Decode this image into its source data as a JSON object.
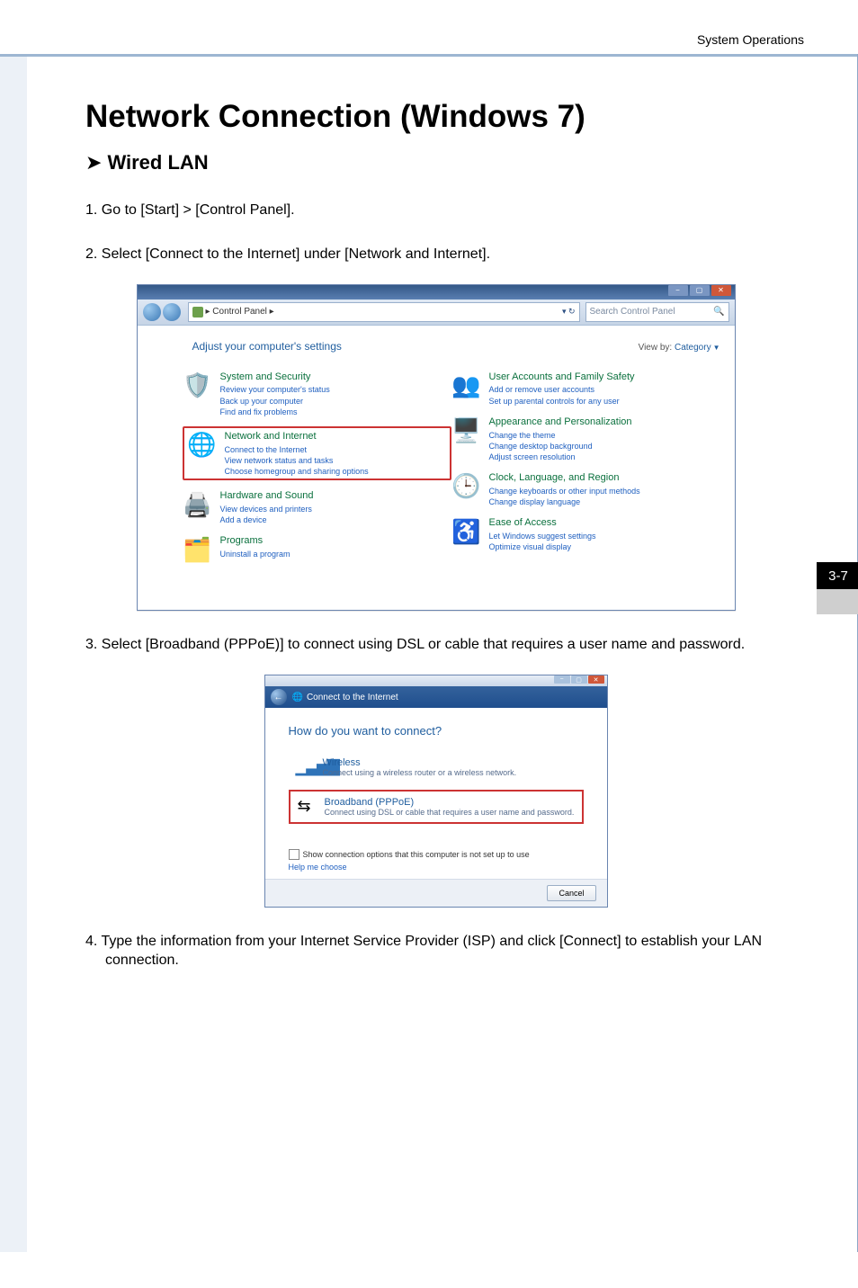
{
  "header_right": "System Operations",
  "title": "Network Connection (Windows 7)",
  "subtitle": "Wired LAN",
  "step1": "1. Go to [Start] > [Control Panel].",
  "step2": "2. Select [Connect to the Internet] under [Network and Internet].",
  "step3": "3.  Select  [Broadband  (PPPoE)]  to  connect  using  DSL  or  cable  that  requires  a  user name and password.",
  "step4": "4. Type the information from your Internet Service Provider (ISP) and click [Connect] to establish your LAN connection.",
  "page_num": "3-7",
  "cp": {
    "breadcrumb": "▸ Control Panel ▸",
    "search_placeholder": "Search Control Panel",
    "adjust": "Adjust your computer's settings",
    "viewby_label": "View by:",
    "viewby_value": "Category",
    "left": [
      {
        "title": "System and Security",
        "links": [
          "Review your computer's status",
          "Back up your computer",
          "Find and fix problems"
        ]
      },
      {
        "title": "Network and Internet",
        "links": [
          "Connect to the Internet",
          "View network status and tasks",
          "Choose homegroup and sharing options"
        ]
      },
      {
        "title": "Hardware and Sound",
        "links": [
          "View devices and printers",
          "Add a device"
        ]
      },
      {
        "title": "Programs",
        "links": [
          "Uninstall a program"
        ]
      }
    ],
    "right": [
      {
        "title": "User Accounts and Family Safety",
        "links": [
          "Add or remove user accounts",
          "Set up parental controls for any user"
        ]
      },
      {
        "title": "Appearance and Personalization",
        "links": [
          "Change the theme",
          "Change desktop background",
          "Adjust screen resolution"
        ]
      },
      {
        "title": "Clock, Language, and Region",
        "links": [
          "Change keyboards or other input methods",
          "Change display language"
        ]
      },
      {
        "title": "Ease of Access",
        "links": [
          "Let Windows suggest settings",
          "Optimize visual display"
        ]
      }
    ]
  },
  "dlg": {
    "nav_title": "Connect to the Internet",
    "question": "How do you want to connect?",
    "opt_wireless_title": "Wireless",
    "opt_wireless_desc": "Connect using a wireless router or a wireless network.",
    "opt_pppoe_title": "Broadband (PPPoE)",
    "opt_pppoe_desc": "Connect using DSL or cable that requires a user name and password.",
    "show_label": "Show connection options that this computer is not set up to use",
    "help_link": "Help me choose",
    "cancel": "Cancel"
  }
}
